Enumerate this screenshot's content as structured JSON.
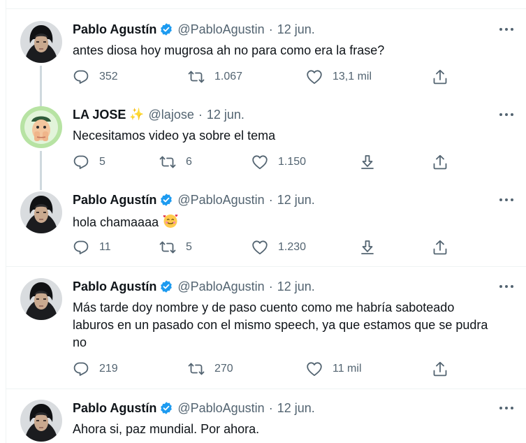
{
  "colors": {
    "verified": "#1d9bf0",
    "icon": "#536471",
    "text": "#0f1419",
    "thread_line": "#cfd9de",
    "separator": "#eff3f4"
  },
  "tweets": [
    {
      "name": "Pablo Agustín",
      "verified": true,
      "handle": "@PabloAgustin",
      "dot": "·",
      "time": "12 jun.",
      "text": "antes diosa hoy mugrosa ah no para como era la frase?",
      "replies": "352",
      "retweets": "1.067",
      "likes": "13,1 mil",
      "more": "more-icon",
      "share": "share-icon"
    },
    {
      "name": "LA JOSE",
      "verified": false,
      "handle": "@lajose",
      "dot": "·",
      "time": "12 jun.",
      "name_emoji": "✨",
      "text": "Necesitamos video ya sobre el tema",
      "replies": "5",
      "retweets": "6",
      "likes": "1.150",
      "extra_action": "download-icon",
      "share": "share-icon"
    },
    {
      "name": "Pablo Agustín",
      "verified": true,
      "handle": "@PabloAgustin",
      "dot": "·",
      "time": "12 jun.",
      "text": "hola chamaaaa",
      "text_emoji": "smiling-face-with-hearts",
      "replies": "11",
      "retweets": "5",
      "likes": "1.230",
      "extra_action": "download-icon",
      "share": "share-icon"
    },
    {
      "name": "Pablo Agustín",
      "verified": true,
      "handle": "@PabloAgustin",
      "dot": "·",
      "time": "12 jun.",
      "text": "Más tarde doy nombre y de paso cuento como me habría saboteado laburos en un pasado con el mismo speech, ya que estamos que se pudra no",
      "replies": "219",
      "retweets": "270",
      "likes": "11 mil",
      "share": "share-icon"
    },
    {
      "name": "Pablo Agustín",
      "verified": true,
      "handle": "@PabloAgustin",
      "dot": "·",
      "time": "12 jun.",
      "text": "Ahora si, paz mundial. Por ahora."
    }
  ]
}
